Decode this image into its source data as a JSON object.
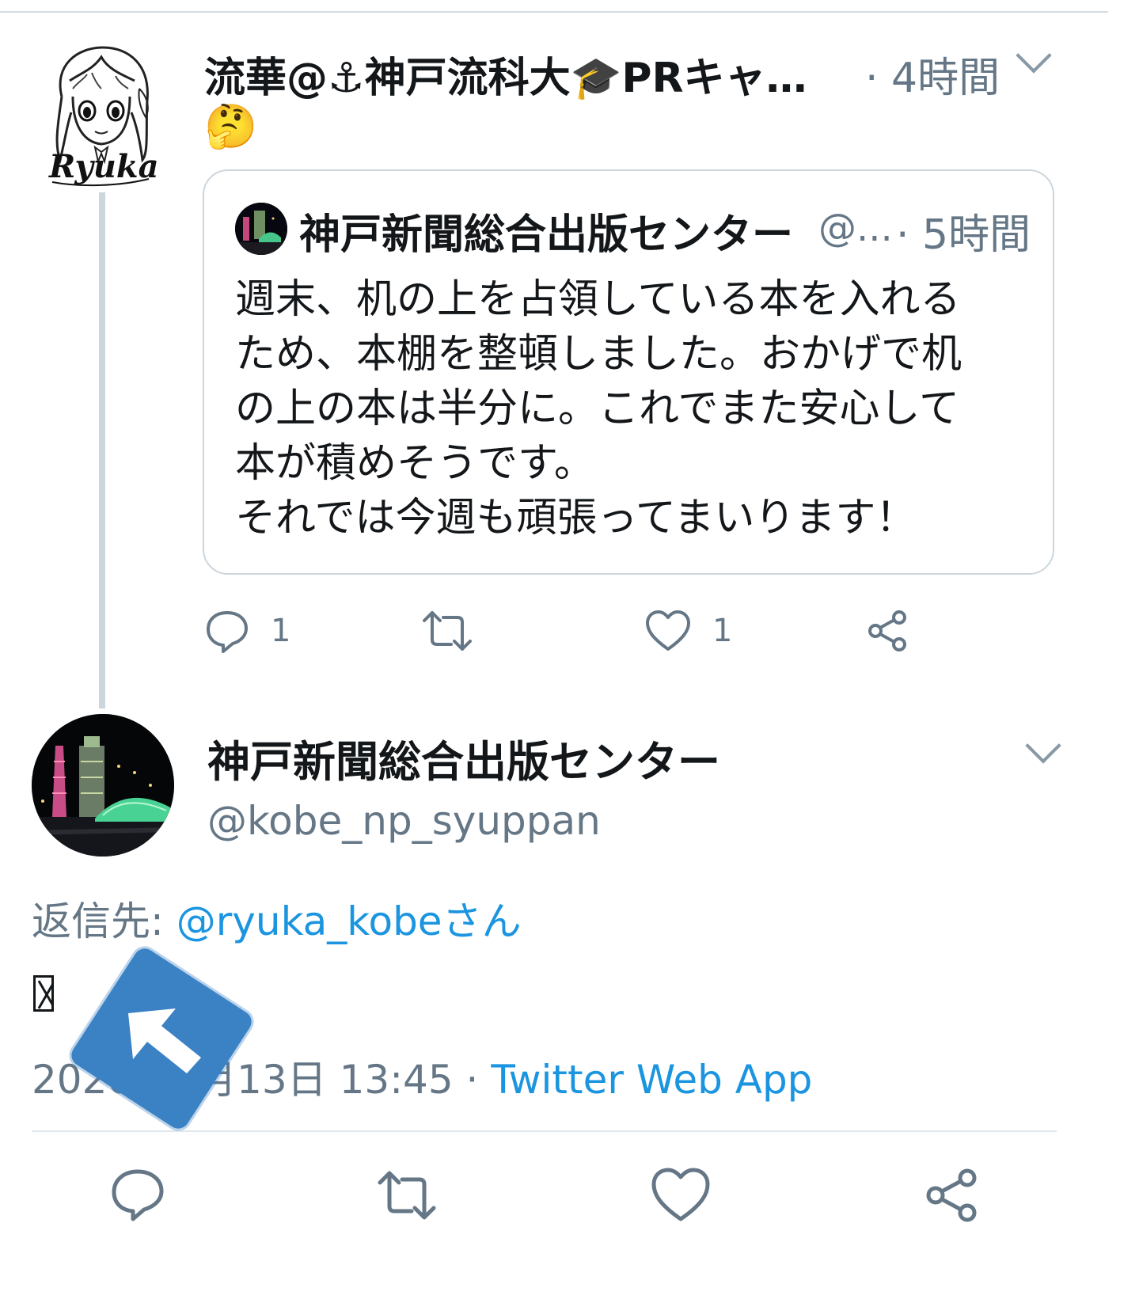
{
  "first_tweet": {
    "author_name": "流華@⚓神戸流科大🎓PRキャ…",
    "time": "· 4時間",
    "reaction_emoji": "🤔",
    "avatar_text": "Ryuka",
    "quoted": {
      "name": "神戸新聞総合出版センター",
      "handle": "@...",
      "time": "· 5時間",
      "lines": [
        "週末、机の上を占領している本を入れる",
        "ため、本棚を整頓しました。おかげで机",
        "の上の本は半分に。これでまた安心して",
        "本が積めそうです。",
        "それでは今週も頑張ってまいります！"
      ]
    },
    "actions": {
      "reply_count": "1",
      "like_count": "1"
    }
  },
  "main_tweet": {
    "name": "神戸新聞総合出版センター",
    "handle": "@kobe_np_syuppan",
    "reply_prefix": "返信先: ",
    "reply_target": "@ryuka_kobeさん",
    "datetime": "2020年1月13日 13:45 · ",
    "source": "Twitter Web App"
  },
  "colors": {
    "link": "#1b95e0",
    "muted": "#657786",
    "overlay": "#3b82c4"
  },
  "icons": [
    "chevron-down-icon",
    "reply-icon",
    "retweet-icon",
    "like-icon",
    "share-icon",
    "arrow-up-left-icon"
  ]
}
